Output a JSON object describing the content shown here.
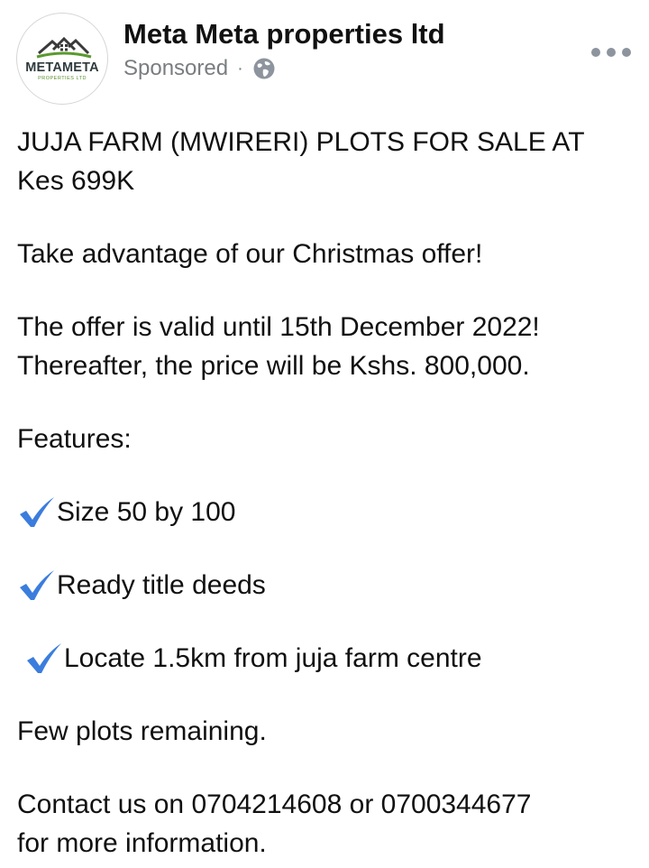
{
  "post": {
    "page_name": "Meta Meta properties ltd",
    "sponsored_label": "Sponsored",
    "separator": "·",
    "audience_icon": "globe-icon",
    "more_icon": "more-options-icon",
    "avatar": {
      "logo_text": "METAMETA",
      "logo_subtext": "PROPERTIES LTD",
      "colors": {
        "roof": "#3a3a3a",
        "accent_green": "#5a9a2e"
      }
    },
    "body": {
      "headline_line1": "JUJA FARM (MWIRERI) PLOTS FOR SALE AT",
      "headline_line2": "Kes 699K",
      "offer": "Take advantage of our Christmas offer!",
      "validity_line1": "The offer is valid until 15th December 2022!",
      "validity_line2": "Thereafter, the price will be Kshs. 800,000.",
      "features_heading": "Features:",
      "features": [
        "Size 50 by 100",
        "Ready title deeds",
        "Locate 1.5km from juja farm centre"
      ],
      "remaining": "Few plots remaining.",
      "contact_line1": "Contact us on 0704214608 or 0700344677",
      "contact_line2": "for more information."
    },
    "check_icon": "check-mark-icon",
    "colors": {
      "check": "#3b7ddd",
      "muted": "#7a7d80",
      "dots": "#8d949e"
    }
  }
}
